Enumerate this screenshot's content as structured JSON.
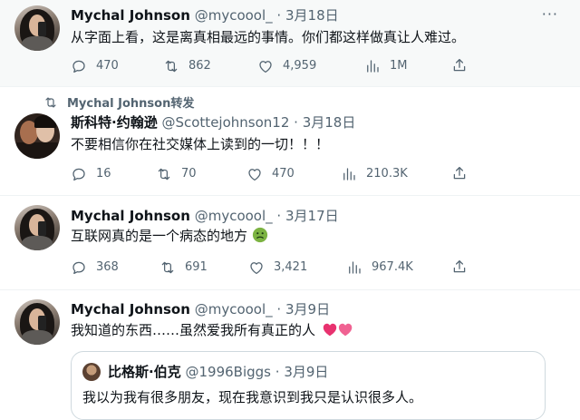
{
  "tweets": [
    {
      "name": "Mychal Johnson",
      "handle": "@mycoool_",
      "dot": "·",
      "date": "3月18日",
      "text": "从字面上看，这是离真相最远的事情。你们都这样做真让人难过。",
      "replies": "470",
      "retweets": "862",
      "likes": "4,959",
      "views": "1M"
    },
    {
      "retweeted_by": "Mychal Johnson转发",
      "name": "斯科特·约翰逊",
      "handle": "@Scottejohnson12",
      "dot": "·",
      "date": "3月18日",
      "text": "不要相信你在社交媒体上读到的一切！！！",
      "replies": "16",
      "retweets": "70",
      "likes": "470",
      "views": "210.3K"
    },
    {
      "name": "Mychal Johnson",
      "handle": "@mycoool_",
      "dot": "·",
      "date": "3月17日",
      "text": "互联网真的是一个病态的地方",
      "emoji_icon": "nauseated-face-emoji",
      "replies": "368",
      "retweets": "691",
      "likes": "3,421",
      "views": "967.4K"
    },
    {
      "name": "Mychal Johnson",
      "handle": "@mycoool_",
      "dot": "·",
      "date": "3月9日",
      "text": "我知道的东西……虽然爱我所有真正的人",
      "emoji_icon": "two-hearts-emoji",
      "quote": {
        "name": "比格斯·伯克",
        "handle": "@1996Biggs",
        "dot": "·",
        "date": "3月9日",
        "text": "我以为我有很多朋友，现在我意识到我只是认识很多人。"
      }
    }
  ],
  "more_label": "···",
  "icons": [
    "reply-icon",
    "retweet-icon",
    "like-icon",
    "views-icon",
    "share-icon"
  ],
  "colors": {
    "muted": "#536471",
    "text": "#0f1419",
    "border": "#eff3f4",
    "highlight_bg": "#f7f9f9"
  }
}
